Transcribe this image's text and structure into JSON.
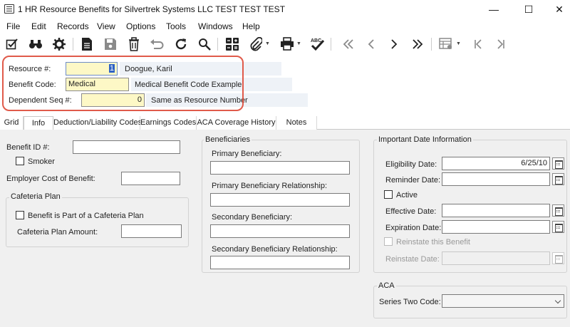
{
  "window": {
    "title": "1 HR Resource Benefits for Silvertrek Systems LLC TEST TEST TEST",
    "minimize": "—",
    "maximize": "☐",
    "close": "✕"
  },
  "menu": [
    "File",
    "Edit",
    "Records",
    "View",
    "Options",
    "Tools",
    "Windows",
    "Help"
  ],
  "toolbar": {
    "icons": [
      "edit-check-icon",
      "binoculars-icon",
      "settings-gear-icon",
      "document-icon",
      "save-icon",
      "delete-icon",
      "undo-icon",
      "refresh-icon",
      "search-icon",
      "calculator-icon",
      "attach-icon",
      "print-icon",
      "spell-check-icon",
      "first-record-icon",
      "previous-record-icon",
      "next-record-icon",
      "last-record-icon",
      "grid-view-icon",
      "go-first-icon",
      "go-last-icon"
    ],
    "spell_label": "ABC"
  },
  "header": {
    "resource_label": "Resource #:",
    "resource_value": "1",
    "resource_name": "Doogue, Karil",
    "benefit_code_label": "Benefit Code:",
    "benefit_code_value": "Medical",
    "benefit_code_desc": "Medical Benefit Code Example",
    "dependent_label": "Dependent Seq #:",
    "dependent_value": "0",
    "dependent_desc": "Same as Resource Number"
  },
  "tabs": [
    "Grid",
    "Info",
    "Deduction/Liability Codes",
    "Earnings Codes",
    "ACA Coverage History",
    "Notes"
  ],
  "active_tab": "Info",
  "info": {
    "benefit_id_label": "Benefit ID #:",
    "benefit_id_value": "",
    "smoker_label": "Smoker",
    "employer_cost_label": "Employer Cost of Benefit:",
    "employer_cost_value": "",
    "cafeteria_group": "Cafeteria Plan",
    "cafeteria_check_label": "Benefit is Part of a Cafeteria Plan",
    "cafeteria_amount_label": "Cafeteria Plan Amount:",
    "cafeteria_amount_value": ""
  },
  "beneficiaries": {
    "group": "Beneficiaries",
    "primary_label": "Primary Beneficiary:",
    "primary_value": "",
    "primary_rel_label": "Primary Beneficiary Relationship:",
    "primary_rel_value": "",
    "secondary_label": "Secondary Beneficiary:",
    "secondary_value": "",
    "secondary_rel_label": "Secondary Beneficiary Relationship:",
    "secondary_rel_value": ""
  },
  "dates": {
    "group": "Important Date Information",
    "eligibility_label": "Eligibility Date:",
    "eligibility_value": "6/25/10",
    "reminder_label": "Reminder Date:",
    "reminder_value": "",
    "active_label": "Active",
    "effective_label": "Effective Date:",
    "effective_value": "",
    "expiration_label": "Expiration Date:",
    "expiration_value": "",
    "reinstate_check_label": "Reinstate this Benefit",
    "reinstate_label": "Reinstate Date:",
    "reinstate_value": ""
  },
  "aca": {
    "group": "ACA",
    "series_two_label": "Series Two Code:",
    "series_two_value": ""
  },
  "colors": {
    "highlight_border": "#e05a4a",
    "required_field": "#fdf8c6",
    "panel_bg": "#f0f0f0"
  }
}
